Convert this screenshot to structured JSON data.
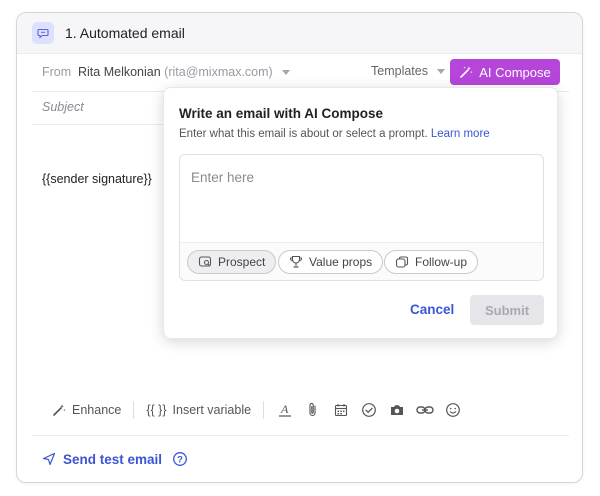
{
  "step": {
    "icon": "chat-bubble-icon",
    "title": "1. Automated email"
  },
  "compose": {
    "from_label": "From",
    "from_name": "Rita Melkonian",
    "from_email": "(rita@mixmax.com)",
    "templates_label": "Templates",
    "ai_compose_label": "AI Compose",
    "subject_placeholder": "Subject",
    "body_text": "{{sender signature}}"
  },
  "toolbar": {
    "enhance_label": "Enhance",
    "insert_variable_prefix": "{{ }}",
    "insert_variable_label": "Insert variable",
    "icons": [
      "text-format-icon",
      "attachment-icon",
      "calendar-icon",
      "checkmark-circle-icon",
      "camera-icon",
      "link-icon",
      "smiley-icon"
    ]
  },
  "footer": {
    "send_test_label": "Send test email"
  },
  "ai_popover": {
    "title": "Write an email with AI Compose",
    "subtitle": "Enter what this email is about or select a prompt.",
    "learn_more": "Learn more",
    "input_placeholder": "Enter here",
    "prompts": [
      {
        "label": "Prospect",
        "icon": "prospect-icon",
        "selected": true
      },
      {
        "label": "Value props",
        "icon": "trophy-icon",
        "selected": false
      },
      {
        "label": "Follow-up",
        "icon": "follow-up-icon",
        "selected": false
      }
    ],
    "cancel_label": "Cancel",
    "submit_label": "Submit"
  },
  "colors": {
    "accent_purple": "#b645d9",
    "link_blue": "#3b55d6",
    "step_icon_bg": "#dde0ff"
  }
}
